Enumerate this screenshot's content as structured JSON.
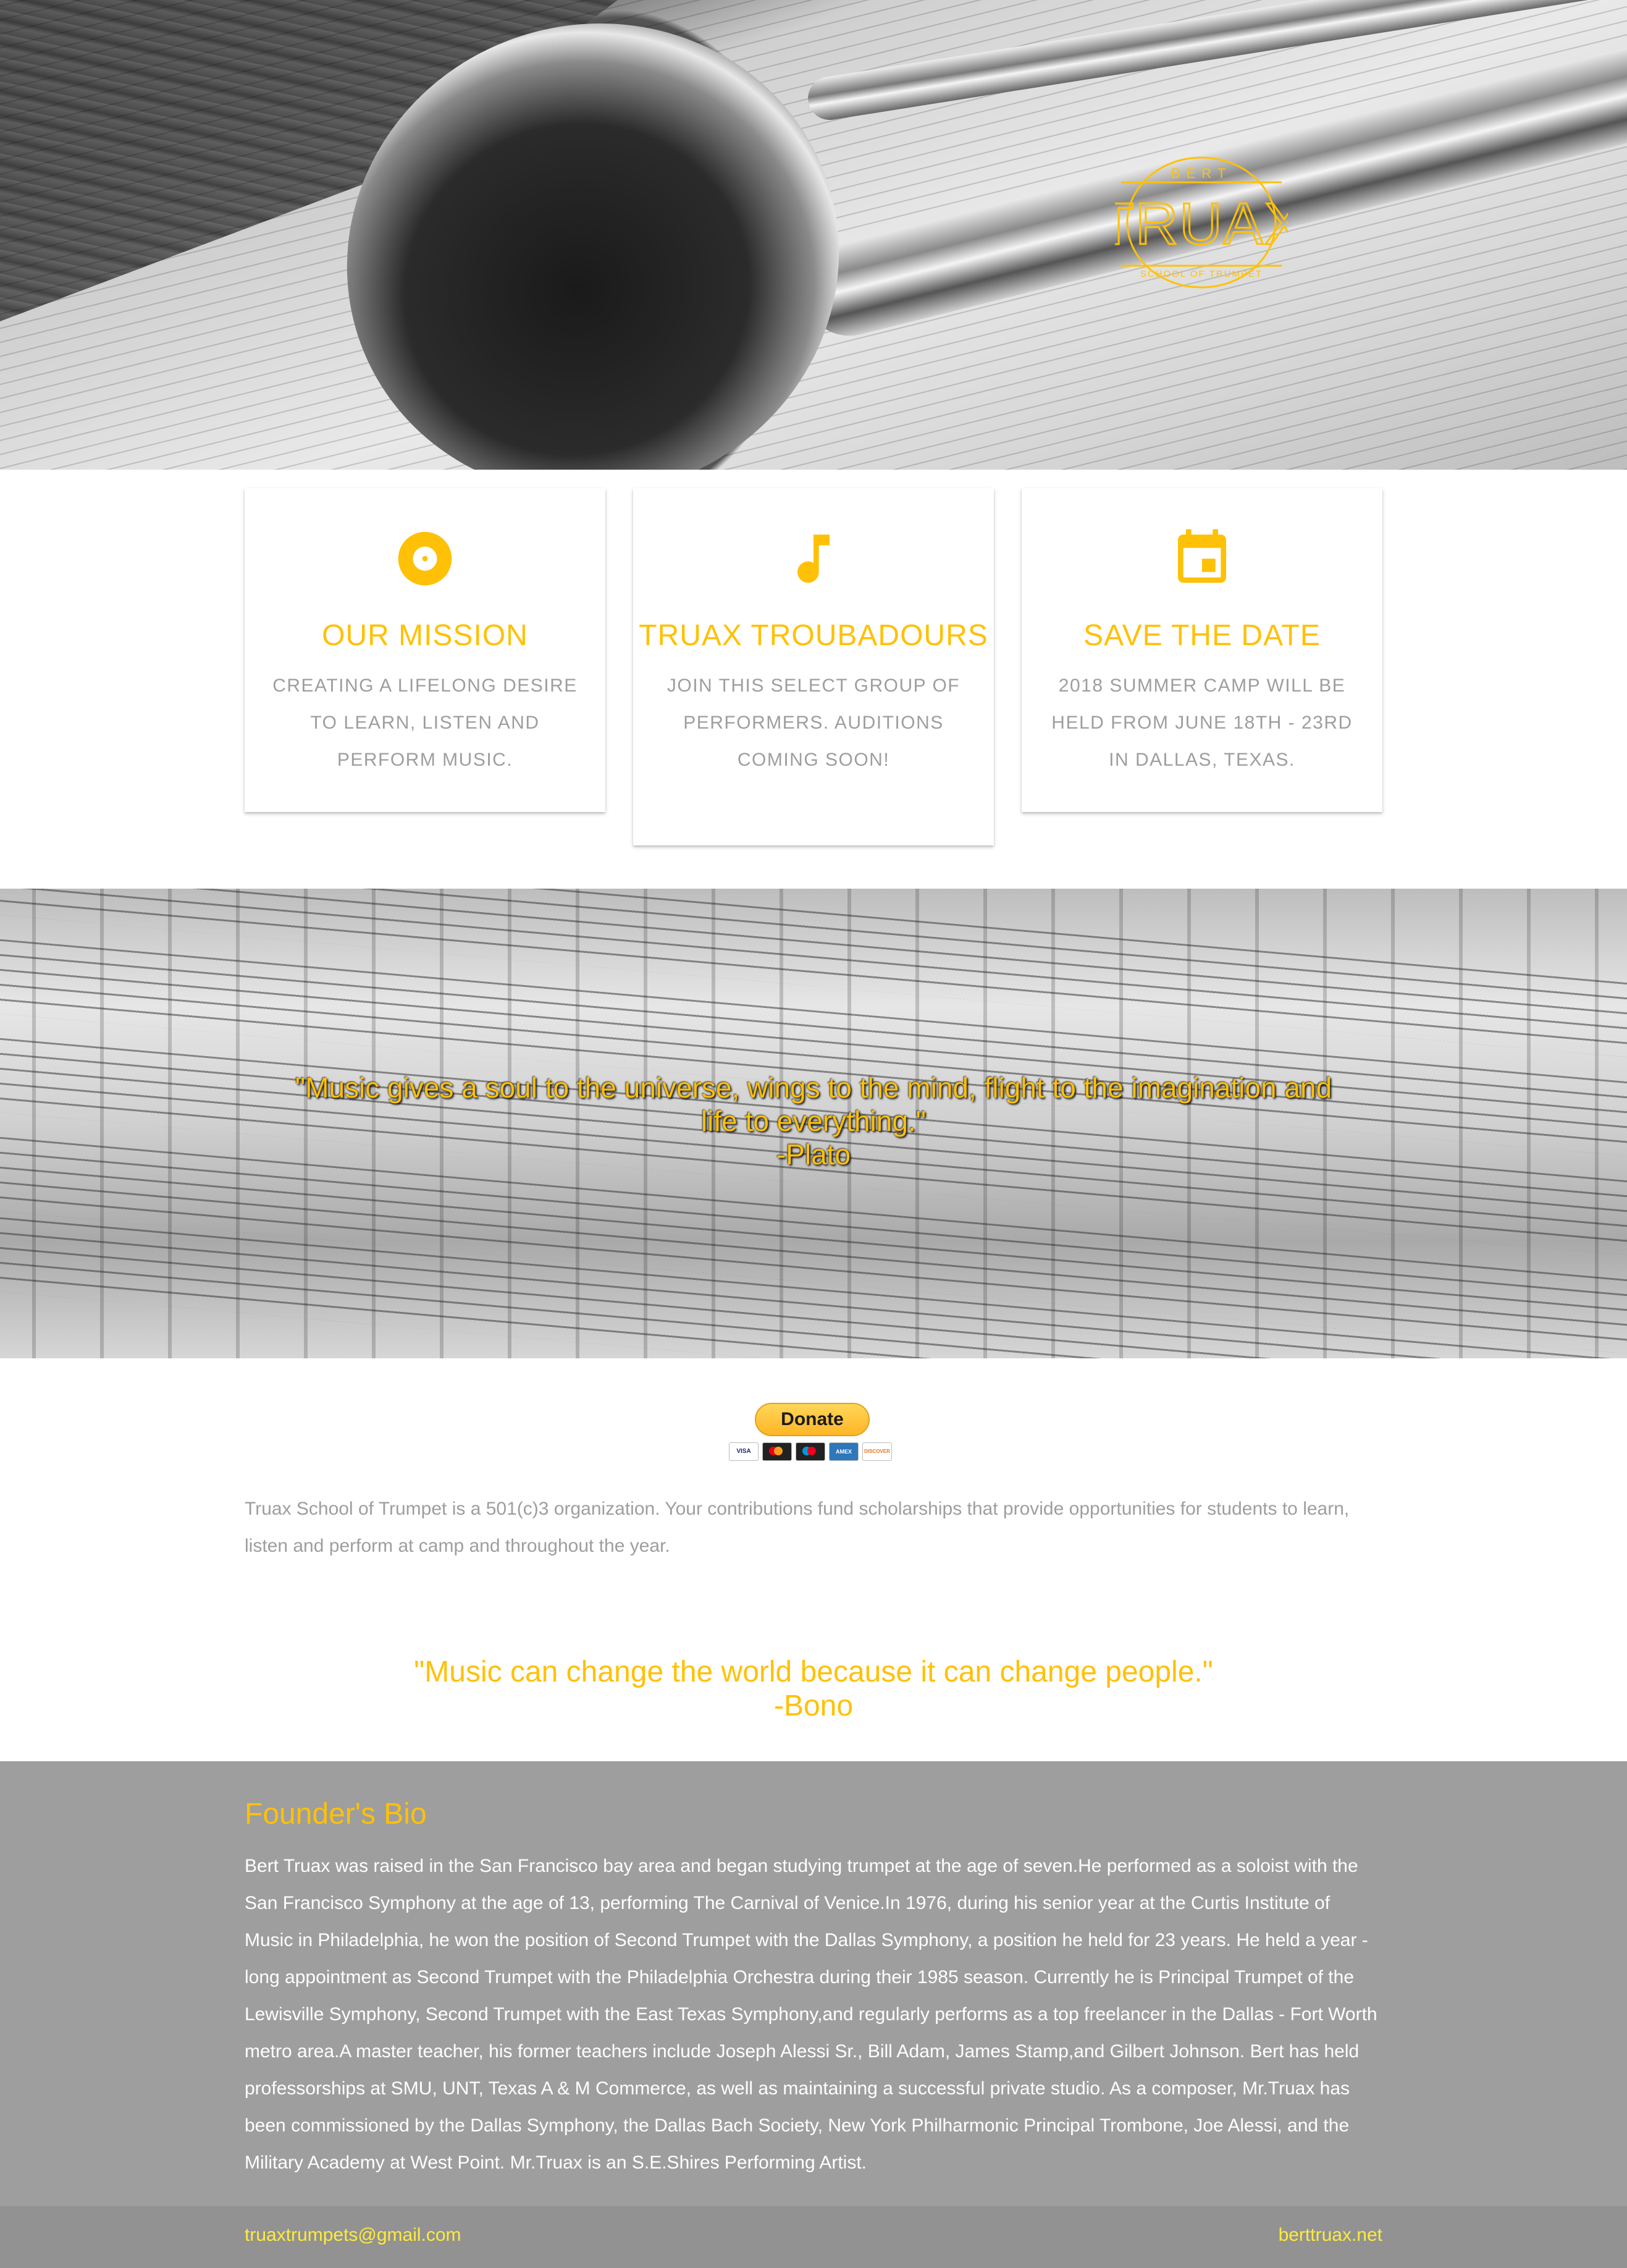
{
  "hero": {
    "logo": {
      "top_text": "BERT",
      "main_text": "TRUAX",
      "bottom_text": "SCHOOL OF TRUMPET"
    }
  },
  "cards": [
    {
      "icon": "disc-icon",
      "title": "OUR MISSION",
      "text": "CREATING A LIFELONG DESIRE TO LEARN, LISTEN AND PERFORM MUSIC."
    },
    {
      "icon": "music-note-icon",
      "title": "TRUAX TROUBADOURS",
      "text": "JOIN THIS SELECT GROUP OF PERFORMERS. AUDITIONS COMING SOON!"
    },
    {
      "icon": "calendar-icon",
      "title": "SAVE THE DATE",
      "text": "2018 SUMMER CAMP WILL BE HELD FROM JUNE 18TH - 23RD IN DALLAS, TEXAS."
    }
  ],
  "plato_quote": {
    "line1": "\"Music gives a soul to the universe, wings to the mind, flight to the imagination and",
    "line2": "life to everything.\"",
    "author": "-Plato"
  },
  "donate": {
    "button_label": "Donate",
    "card_labels": [
      "VISA",
      "",
      "",
      "AMEX",
      "DISCOVER"
    ]
  },
  "org_text": "Truax School of Trumpet is a 501(c)3 organization. Your contributions fund scholarships that provide opportunities for students to learn, listen and perform at camp and throughout the year.",
  "bono_quote": {
    "text": "\"Music can change the world because it can change people.\"",
    "author": "-Bono"
  },
  "bio": {
    "title": "Founder's Bio",
    "text": "Bert Truax was raised in the San Francisco bay area and began studying trumpet at the age of seven.He performed as a soloist with the San Francisco Symphony at the age of 13, performing The Carnival of Venice.In 1976, during his senior year at the Curtis Institute of Music in Philadelphia, he won the position of Second Trumpet with the Dallas Symphony, a position he held for 23 years. He held a year - long appointment as Second Trumpet with the Philadelphia Orchestra during their 1985 season. Currently he is Principal Trumpet of the Lewisville Symphony, Second Trumpet with the East Texas Symphony,and regularly performs as a top freelancer in the Dallas - Fort Worth metro area.A master teacher, his former teachers include Joseph Alessi Sr., Bill Adam, James Stamp,and Gilbert Johnson. Bert has held professorships at SMU, UNT, Texas A & M Commerce, as well as maintaining a successful private studio. As a composer, Mr.Truax has been commissioned by the Dallas Symphony, the Dallas Bach Society, New York Philharmonic Principal Trombone, Joe Alessi, and the Military Academy at West Point. Mr.Truax is an S.E.Shires Performing Artist."
  },
  "footer": {
    "email": "truaxtrumpets@gmail.com",
    "site": "berttruax.net"
  },
  "colors": {
    "accent": "#ffc107",
    "footer_link": "#ffeb3b",
    "text_gray": "#9e9e9e",
    "bio_bg": "#9e9e9e"
  }
}
